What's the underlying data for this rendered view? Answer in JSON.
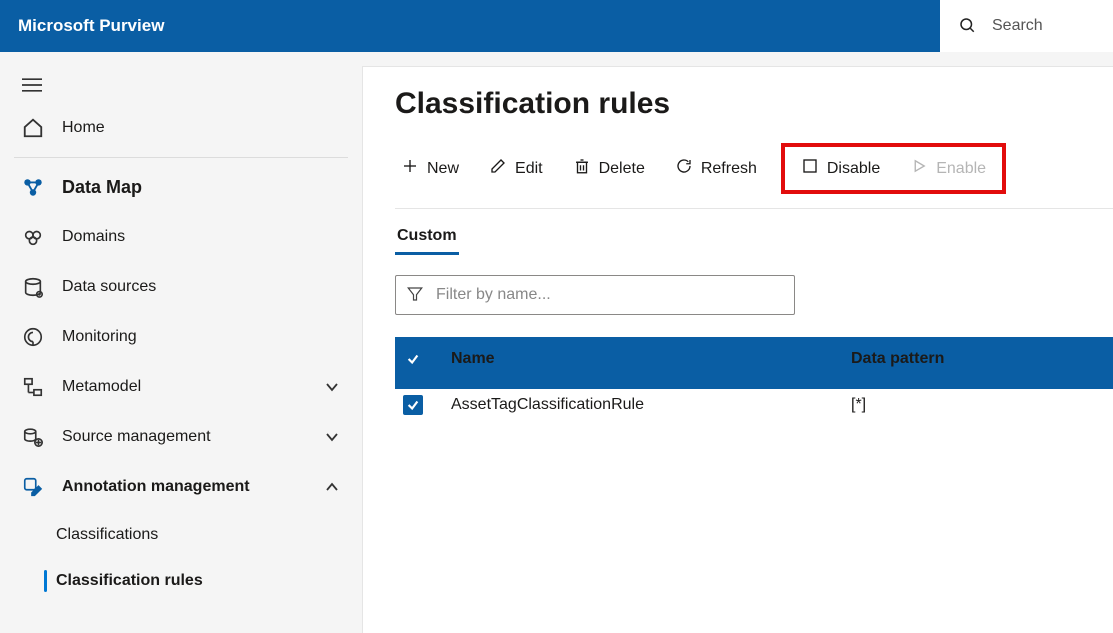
{
  "brand": "Microsoft Purview",
  "search": {
    "placeholder": "Search"
  },
  "nav": {
    "home": "Home",
    "datamap": "Data Map",
    "domains": "Domains",
    "datasources": "Data sources",
    "monitoring": "Monitoring",
    "metamodel": "Metamodel",
    "source_mgmt": "Source management",
    "annotation_mgmt": "Annotation management",
    "classifications": "Classifications",
    "classification_rules": "Classification rules"
  },
  "page": {
    "title": "Classification rules",
    "toolbar": {
      "new": "New",
      "edit": "Edit",
      "delete": "Delete",
      "refresh": "Refresh",
      "disable": "Disable",
      "enable": "Enable"
    },
    "tabs": {
      "custom": "Custom"
    },
    "filter_placeholder": "Filter by name...",
    "table": {
      "headers": {
        "name": "Name",
        "pattern": "Data pattern"
      },
      "rows": [
        {
          "name": "AssetTagClassificationRule",
          "pattern": "[*]"
        }
      ]
    }
  }
}
